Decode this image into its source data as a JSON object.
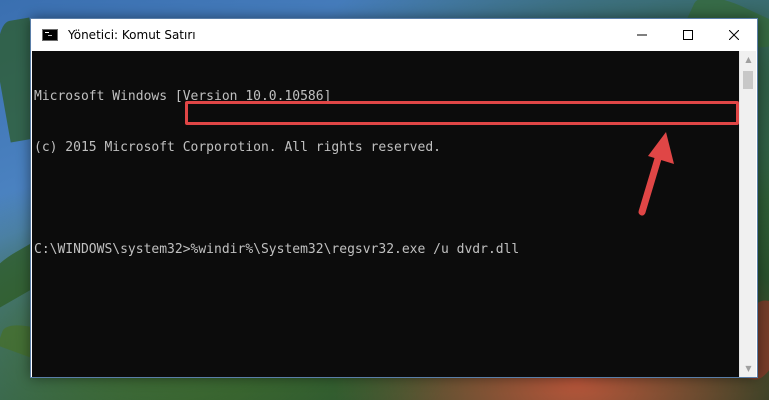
{
  "window": {
    "title": "Yönetici: Komut Satırı",
    "controls": {
      "minimize": "—",
      "maximize": "☐",
      "close": "✕"
    }
  },
  "console": {
    "lines": [
      "Microsoft Windows [Version 10.0.10586]",
      "(c) 2015 Microsoft Corporotion. All rights reserved.",
      "",
      "C:\\WINDOWS\\system32>%windir%\\System32\\regsvr32.exe /u dvdr.dll"
    ],
    "text_color": "#c0c0c0",
    "background": "#0c0c0c"
  },
  "annotation": {
    "box_color": "#e04646",
    "arrow_color": "#e04646"
  }
}
